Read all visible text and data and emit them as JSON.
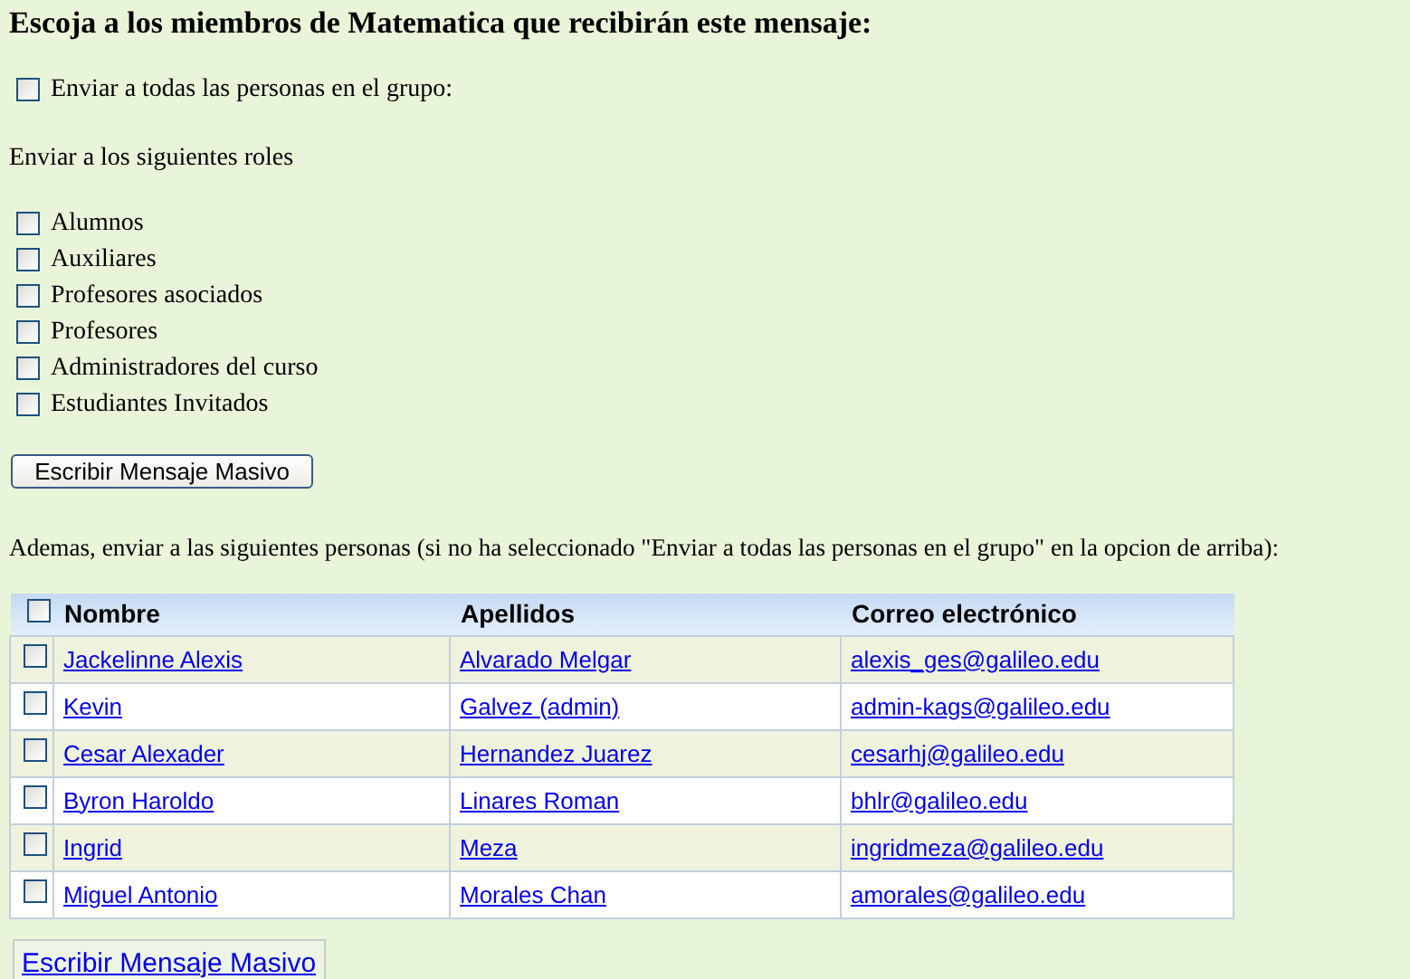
{
  "heading": "Escoja a los miembros de Matematica que recibirán este mensaje:",
  "all_members": {
    "label": "Enviar a todas las personas en el grupo:",
    "checked": false
  },
  "roles_label": "Enviar a los siguientes roles",
  "roles": [
    {
      "label": "Alumnos",
      "checked": false
    },
    {
      "label": "Auxiliares",
      "checked": false
    },
    {
      "label": "Profesores asociados",
      "checked": false
    },
    {
      "label": "Profesores",
      "checked": false
    },
    {
      "label": "Administradores del curso",
      "checked": false
    },
    {
      "label": "Estudiantes Invitados",
      "checked": false
    }
  ],
  "write_button": "Escribir Mensaje Masivo",
  "people_label": "Ademas, enviar a las siguientes personas (si no ha seleccionado \"Enviar a todas las personas en el grupo\" en la opcion de arriba):",
  "table": {
    "select_all_checked": false,
    "columns": [
      "Nombre",
      "Apellidos",
      "Correo electrónico"
    ],
    "rows": [
      {
        "checked": false,
        "cells": [
          "Jackelinne Alexis",
          "Alvarado Melgar",
          "alexis_ges@galileo.edu"
        ]
      },
      {
        "checked": false,
        "cells": [
          "Kevin",
          "Galvez (admin)",
          "admin-kags@galileo.edu"
        ]
      },
      {
        "checked": false,
        "cells": [
          "Cesar Alexader",
          "Hernandez Juarez",
          "cesarhj@galileo.edu"
        ]
      },
      {
        "checked": false,
        "cells": [
          "Byron Haroldo",
          "Linares Roman",
          "bhlr@galileo.edu"
        ]
      },
      {
        "checked": false,
        "cells": [
          "Ingrid",
          "Meza",
          "ingridmeza@galileo.edu"
        ]
      },
      {
        "checked": false,
        "cells": [
          "Miguel Antonio",
          "Morales Chan",
          "amorales@galileo.edu"
        ]
      }
    ]
  },
  "bottom_link": "Escribir Mensaje Masivo"
}
